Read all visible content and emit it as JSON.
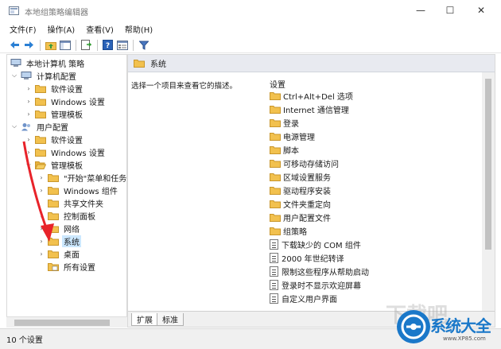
{
  "window": {
    "title": "本地组策略编辑器",
    "minimize": "—",
    "maximize": "☐",
    "close": "✕"
  },
  "menu": [
    "文件(F)",
    "操作(A)",
    "查看(V)",
    "帮助(H)"
  ],
  "tree": {
    "root": "本地计算机 策略",
    "computer_config": "计算机配置",
    "computer_children": [
      "软件设置",
      "Windows 设置",
      "管理模板"
    ],
    "user_config": "用户配置",
    "user_children": [
      "软件设置",
      "Windows 设置",
      "管理模板"
    ],
    "admin_template_children": [
      "\"开始\"菜单和任务栏",
      "Windows 组件",
      "共享文件夹",
      "控制面板",
      "网络",
      "系统",
      "桌面",
      "所有设置"
    ],
    "selected": "系统"
  },
  "right": {
    "header": "系统",
    "description": "选择一个项目来查看它的描述。",
    "column": "设置",
    "folders": [
      "Ctrl+Alt+Del 选项",
      "Internet 通信管理",
      "登录",
      "电源管理",
      "脚本",
      "可移动存储访问",
      "区域设置服务",
      "驱动程序安装",
      "文件夹重定向",
      "用户配置文件",
      "组策略"
    ],
    "policies": [
      "下载缺少的 COM 组件",
      "2000 年世纪转译",
      "限制这些程序从帮助启动",
      "登录时不显示欢迎屏幕",
      "自定义用户界面"
    ]
  },
  "tabs": [
    "扩展",
    "标准"
  ],
  "status": "10 个设置",
  "watermark": {
    "brand": "系统大全",
    "url": "www.XP85.com",
    "faint": "下载吧"
  },
  "colors": {
    "folder": "#f2c14e",
    "selection": "#cce8ff",
    "arrow": "#e8232a",
    "brand": "#1a78c9"
  }
}
